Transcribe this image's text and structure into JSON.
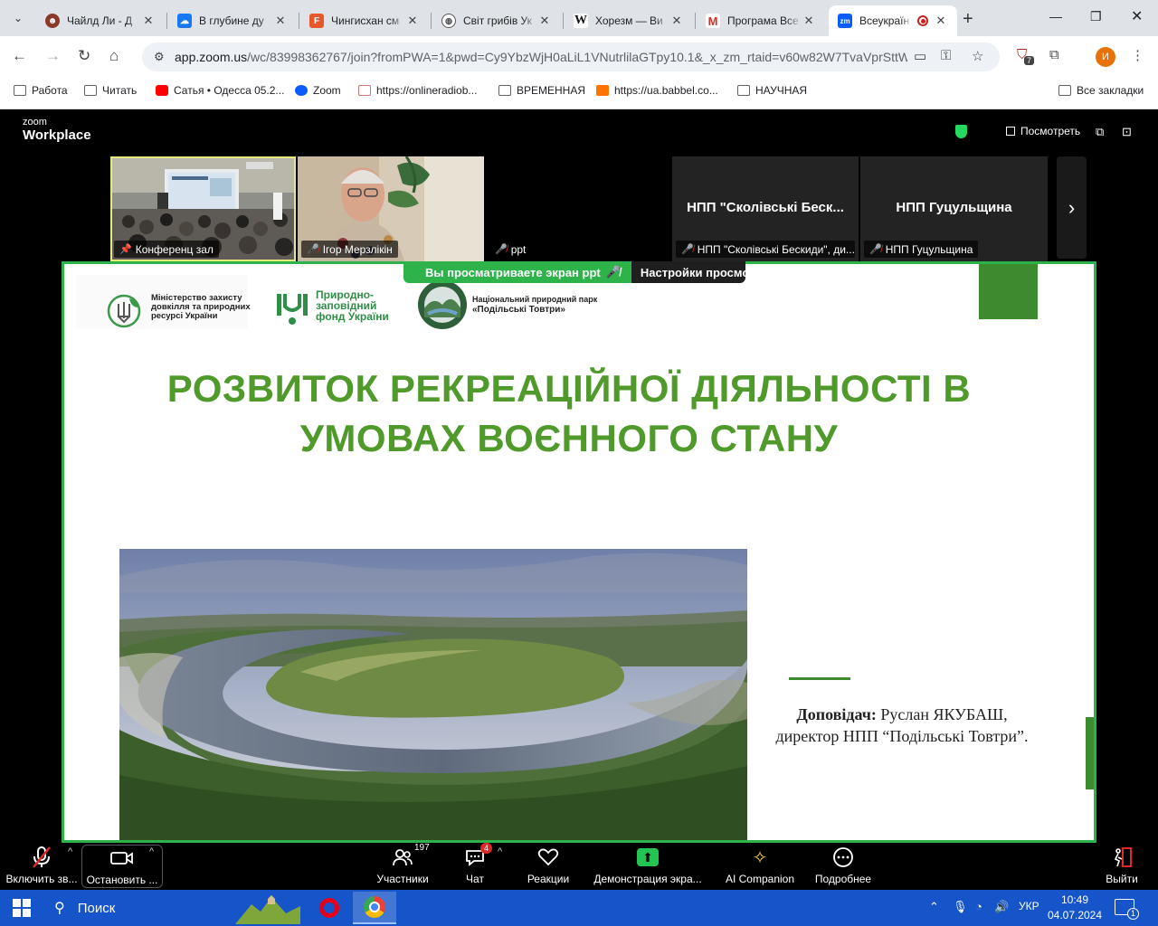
{
  "browser": {
    "tabs": [
      {
        "title": "Чайлд Ли - Д",
        "icon": "devil-icon"
      },
      {
        "title": "В глубине ду",
        "icon": "cloud-icon"
      },
      {
        "title": "Чингисхан см",
        "icon": "f-icon"
      },
      {
        "title": "Світ грибів Ук",
        "icon": "globe-icon"
      },
      {
        "title": "Хорезм — Ви",
        "icon": "wikipedia-icon"
      },
      {
        "title": "Програма Все",
        "icon": "gmail-icon"
      },
      {
        "title": "Всеукраїн",
        "icon": "zoom-icon",
        "active": true
      }
    ],
    "new_tab": "+",
    "url_host": "app.zoom.us",
    "url_path": "/wc/83998362767/join?fromPWA=1&pwd=Cy9YbzWjH0aLiL1VNutrlilaGTpy10.1&_x_zm_rtaid=v60w82W7TvaVprSttW...",
    "extension_badge": "7",
    "profile_initial": "И",
    "bookmarks": [
      {
        "label": "Работа",
        "icon": "folder-icon"
      },
      {
        "label": "Читать",
        "icon": "folder-icon"
      },
      {
        "label": "Сатья • Одесса 05.2...",
        "icon": "youtube-icon"
      },
      {
        "label": "Zoom",
        "icon": "zoom-icon"
      },
      {
        "label": "https://onlineradiob...",
        "icon": "cube-icon"
      },
      {
        "label": "ВРЕМЕННАЯ",
        "icon": "folder-icon"
      },
      {
        "label": "https://ua.babbel.co...",
        "icon": "babbel-icon"
      },
      {
        "label": "НАУЧНАЯ",
        "icon": "folder-icon"
      }
    ],
    "all_bookmarks": "Все закладки"
  },
  "zoom": {
    "logo_top": "zoom",
    "logo_bottom": "Workplace",
    "view_label": "Посмотреть",
    "participants_tiles": [
      {
        "name": "Конференц зал",
        "type": "video-hall"
      },
      {
        "name": "Ігор Мерзлікін",
        "type": "video-person"
      },
      {
        "name": "ppt",
        "type": "blank"
      },
      {
        "name": "НПП \"Сколівські Бескиди\", ди...",
        "big": "НПП \"Сколівські Беск...",
        "type": "name"
      },
      {
        "name": "НПП Гуцульщина",
        "big": "НПП Гуцульщина",
        "type": "name"
      }
    ],
    "share_banner": "Вы просматриваете экран  ppt",
    "view_settings": "Настройки просмотра",
    "toolbar": {
      "unmute": "Включить зв...",
      "stop_video": "Остановить ...",
      "participants": "Участники",
      "participants_count": "197",
      "chat": "Чат",
      "chat_badge": "4",
      "reactions": "Реакции",
      "share": "Демонстрация экра...",
      "ai": "AI Companion",
      "more": "Подробнее",
      "leave": "Выйти"
    }
  },
  "slide": {
    "logo1_text": "Міністерство захисту довкілля та природних ресурсі України",
    "logo2_line1": "Природно-",
    "logo2_line2": "заповідний",
    "logo2_line3": "фонд України",
    "logo3_line1": "Національний природний парк",
    "logo3_line2": "«Подільські Товтри»",
    "title_line1": "РОЗВИТОК РЕКРЕАЦІЙНОЇ ДІЯЛЬНОСТІ В",
    "title_line2": "УМОВАХ ВОЄННОГО СТАНУ",
    "speaker_label": "Доповідач:",
    "speaker_name": " Руслан ЯКУБАШ,",
    "speaker_role": "директор НПП “Подільські Товтри”."
  },
  "taskbar": {
    "search": "Поиск",
    "lang": "УКР",
    "time": "10:49",
    "date": "04.07.2024",
    "notifications": "1"
  },
  "colors": {
    "zoom_green": "#2db34a",
    "slide_green": "#4f9a2b",
    "taskbar": "#1654c9"
  }
}
